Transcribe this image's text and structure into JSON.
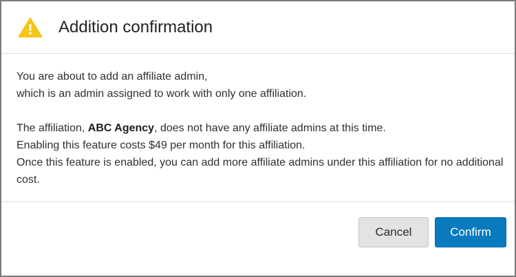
{
  "dialog": {
    "title": "Addition confirmation",
    "icon": "warning-triangle-icon",
    "warning_color": "#f5c518",
    "body": {
      "line1": "You are about to add an affiliate admin,",
      "line2": "which is an admin assigned to work with only one affiliation.",
      "line3_pre": "The affiliation, ",
      "affiliation_name": "ABC Agency",
      "line3_post": ", does not have any affiliate admins at this time.",
      "line4": "Enabling this feature costs $49 per month for this affiliation.",
      "line5": "Once this feature is enabled, you can add more affiliate admins under this affiliation for no additional cost."
    },
    "buttons": {
      "cancel_label": "Cancel",
      "confirm_label": "Confirm",
      "confirm_color": "#0a7abf"
    }
  }
}
